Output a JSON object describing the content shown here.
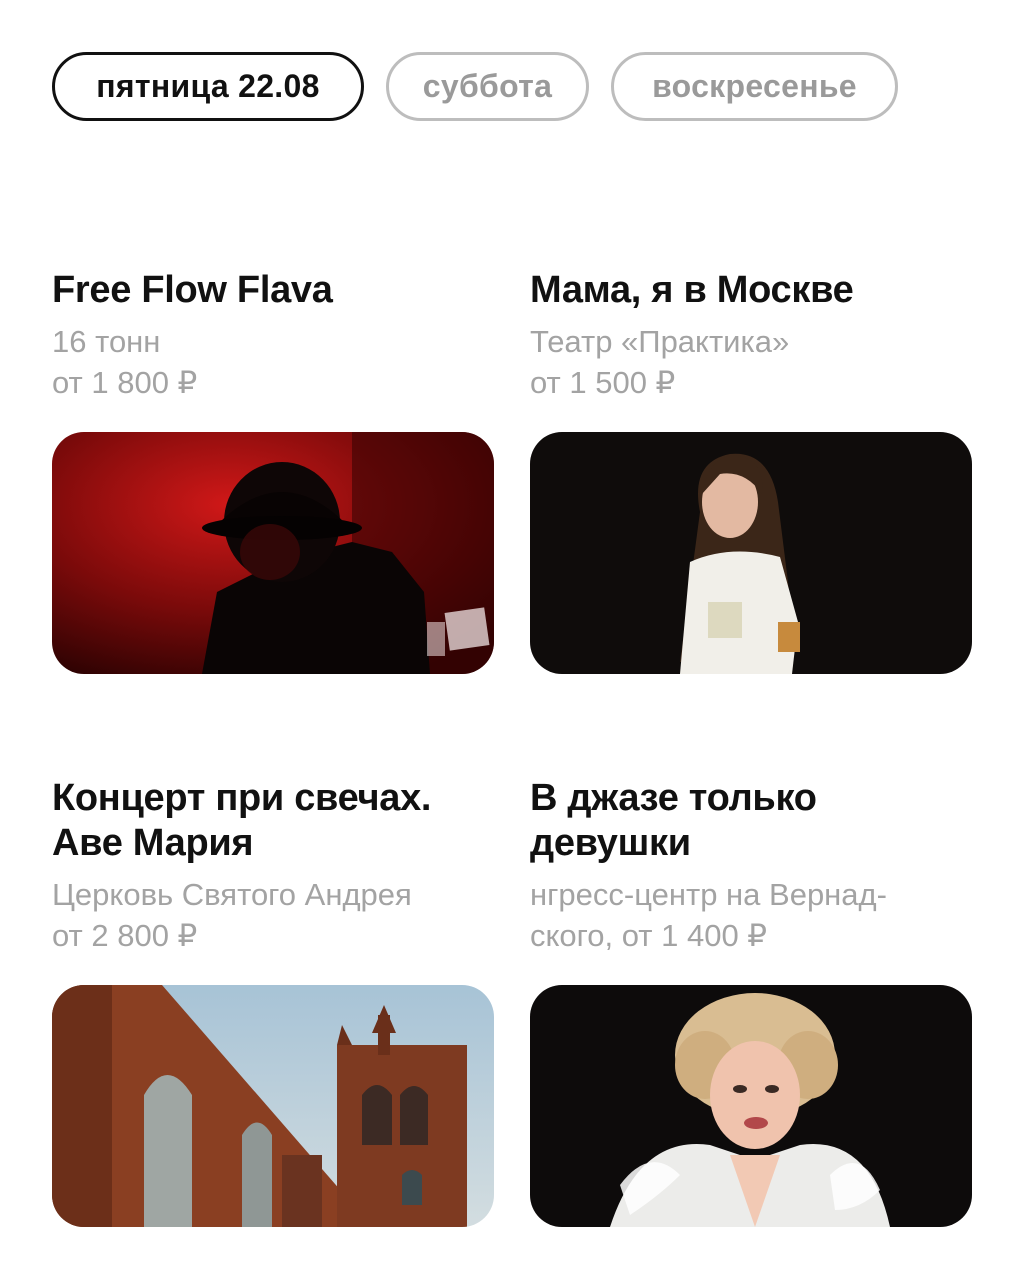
{
  "day_tabs": [
    {
      "label": "пятница 22.08",
      "active": true
    },
    {
      "label": "суббота",
      "active": false
    },
    {
      "label": "воскресенье",
      "active": false
    }
  ],
  "events": [
    {
      "title": "Free Flow Flava",
      "venue": "16 тонн",
      "price": "от 1 800 ₽",
      "image": "performer-in-hat-red-light"
    },
    {
      "title": "Мама, я в Москве",
      "venue": "Театр «Практика»",
      "price": "от 1 500 ₽",
      "image": "actress-on-dark-stage"
    },
    {
      "title_line1": "Концерт при свечах.",
      "title_line2": "Аве Мария",
      "venue": "Церковь Святого Андрея",
      "price": "от 2 800 ₽",
      "image": "red-brick-church"
    },
    {
      "title_line1": "В джазе только",
      "title_line2": "девушки",
      "venue_line1": "нгресс-центр на Вернад-",
      "venue_line2": "ского, от 1 400 ₽",
      "image": "blonde-performer-white-feathers"
    }
  ],
  "colors": {
    "text": "#111111",
    "muted": "#a3a3a3",
    "inactive_border": "#bdbdbd"
  }
}
